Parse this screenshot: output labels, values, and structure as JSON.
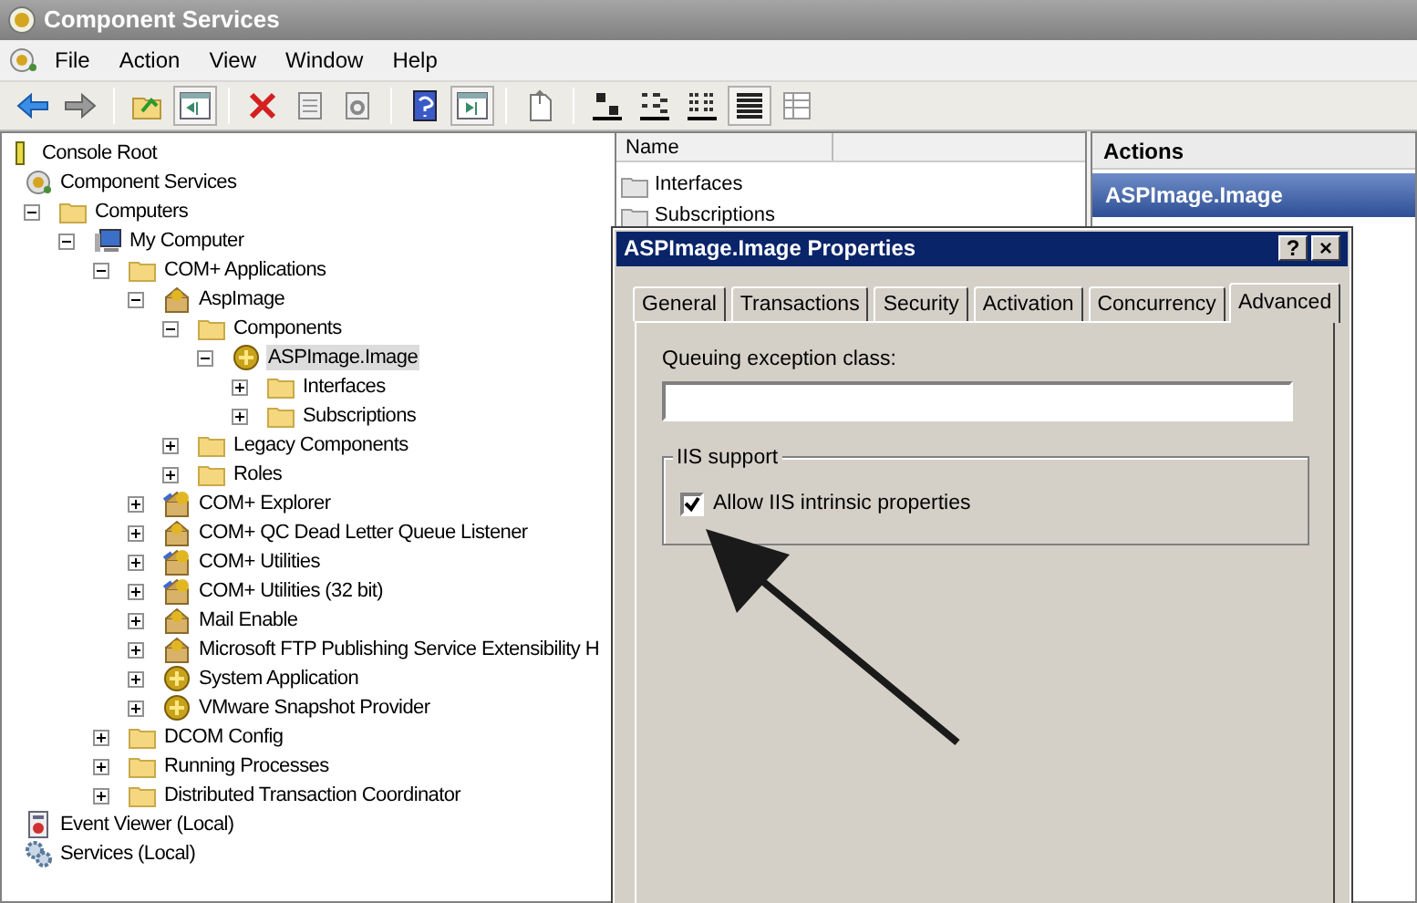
{
  "window": {
    "title": "Component Services"
  },
  "menu": [
    "File",
    "Action",
    "View",
    "Window",
    "Help"
  ],
  "toolbar": [
    {
      "kind": "back",
      "pressed": false
    },
    {
      "kind": "forward",
      "pressed": false
    },
    {
      "kind": "separator"
    },
    {
      "kind": "up",
      "pressed": false
    },
    {
      "kind": "console-tree",
      "pressed": true
    },
    {
      "kind": "separator"
    },
    {
      "kind": "delete",
      "pressed": false
    },
    {
      "kind": "properties",
      "pressed": false
    },
    {
      "kind": "refresh",
      "pressed": false
    },
    {
      "kind": "separator"
    },
    {
      "kind": "help",
      "pressed": false
    },
    {
      "kind": "action-pane",
      "pressed": true
    },
    {
      "kind": "separator"
    },
    {
      "kind": "export",
      "pressed": false
    },
    {
      "kind": "separator"
    },
    {
      "kind": "large-icons",
      "pressed": false
    },
    {
      "kind": "small-icons",
      "pressed": false
    },
    {
      "kind": "list",
      "pressed": false
    },
    {
      "kind": "detail",
      "pressed": true
    },
    {
      "kind": "custom",
      "pressed": false
    }
  ],
  "tree": [
    {
      "label": "Console Root",
      "kind": "root",
      "selected": false,
      "children": [
        {
          "label": "Component Services",
          "kind": "snapin",
          "selected": false,
          "children": [
            {
              "label": "Computers",
              "kind": "folder",
              "expanded": true,
              "selected": false,
              "children": [
                {
                  "label": "My Computer",
                  "kind": "computer",
                  "expanded": true,
                  "selected": false,
                  "children": [
                    {
                      "label": "COM+ Applications",
                      "kind": "folder",
                      "expanded": true,
                      "selected": false,
                      "children": [
                        {
                          "label": "AspImage",
                          "kind": "package",
                          "expanded": true,
                          "selected": false,
                          "children": [
                            {
                              "label": "Components",
                              "kind": "folder",
                              "expanded": true,
                              "selected": false,
                              "children": [
                                {
                                  "label": "ASPImage.Image",
                                  "kind": "component",
                                  "expanded": true,
                                  "selected": true,
                                  "children": [
                                    {
                                      "label": "Interfaces",
                                      "kind": "folder",
                                      "expanded": false,
                                      "selected": false
                                    },
                                    {
                                      "label": "Subscriptions",
                                      "kind": "folder",
                                      "expanded": false,
                                      "selected": false
                                    }
                                  ]
                                }
                              ]
                            },
                            {
                              "label": "Legacy Components",
                              "kind": "folder",
                              "expanded": false,
                              "selected": false
                            },
                            {
                              "label": "Roles",
                              "kind": "folder",
                              "expanded": false,
                              "selected": false
                            }
                          ]
                        },
                        {
                          "label": "COM+ Explorer",
                          "kind": "system",
                          "expanded": false,
                          "selected": false
                        },
                        {
                          "label": "COM+ QC Dead Letter Queue Listener",
                          "kind": "package",
                          "expanded": false,
                          "selected": false
                        },
                        {
                          "label": "COM+ Utilities",
                          "kind": "system",
                          "expanded": false,
                          "selected": false
                        },
                        {
                          "label": "COM+ Utilities (32 bit)",
                          "kind": "system",
                          "expanded": false,
                          "selected": false
                        },
                        {
                          "label": "Mail Enable",
                          "kind": "package",
                          "expanded": false,
                          "selected": false
                        },
                        {
                          "label": "Microsoft FTP Publishing Service Extensibility H",
                          "kind": "package",
                          "expanded": false,
                          "selected": false
                        },
                        {
                          "label": "System Application",
                          "kind": "component",
                          "expanded": false,
                          "selected": false
                        },
                        {
                          "label": "VMware Snapshot Provider",
                          "kind": "component",
                          "expanded": false,
                          "selected": false
                        }
                      ]
                    },
                    {
                      "label": "DCOM Config",
                      "kind": "folder",
                      "expanded": false,
                      "selected": false
                    },
                    {
                      "label": "Running Processes",
                      "kind": "folder",
                      "expanded": false,
                      "selected": false
                    },
                    {
                      "label": "Distributed Transaction Coordinator",
                      "kind": "folder",
                      "expanded": false,
                      "selected": false
                    }
                  ]
                }
              ]
            }
          ]
        },
        {
          "label": "Event Viewer (Local)",
          "kind": "log",
          "selected": false
        },
        {
          "label": "Services (Local)",
          "kind": "services",
          "selected": false
        }
      ]
    }
  ],
  "list": {
    "columns": [
      "Name"
    ],
    "items": [
      {
        "label": "Interfaces"
      },
      {
        "label": "Subscriptions"
      }
    ]
  },
  "actions": {
    "title": "Actions",
    "items": [
      {
        "label": "ASPImage.Image"
      }
    ]
  },
  "dialog": {
    "title": "ASPImage.Image Properties",
    "help_button": "?",
    "close_button": "×",
    "tabs": [
      {
        "label": "General",
        "selected": false
      },
      {
        "label": "Transactions",
        "selected": false
      },
      {
        "label": "Security",
        "selected": false
      },
      {
        "label": "Activation",
        "selected": false
      },
      {
        "label": "Concurrency",
        "selected": false
      },
      {
        "label": "Advanced",
        "selected": true
      }
    ],
    "queuing_exception_class": {
      "label": "Queuing exception class:"
    },
    "iis_support": {
      "title": "IIS support",
      "checkbox": {
        "label": "Allow IIS intrinsic properties",
        "checked": true
      }
    }
  }
}
